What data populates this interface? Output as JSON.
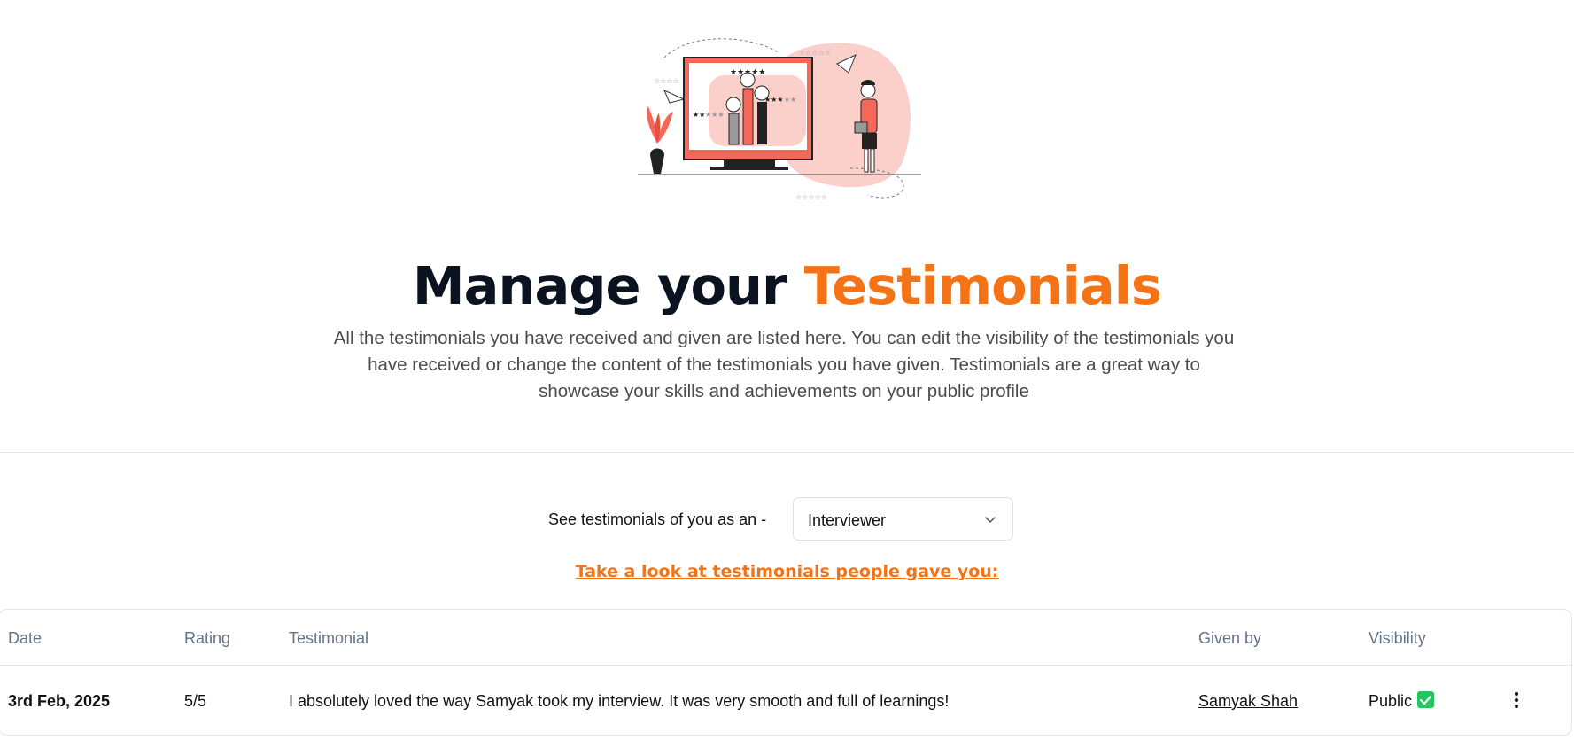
{
  "hero": {
    "illustration": "testimonials-rating-illustration",
    "title_main": "Manage your ",
    "title_accent": "Testimonials",
    "subtitle": "All the testimonials you have received and given are listed here. You can edit the visibility of the testimonials you have received or change the content of the testimonials you have given. Testimonials are a great way to showcase your skills and achievements on your public profile"
  },
  "filter": {
    "label": "See testimonials of you as an -",
    "selected": "Interviewer"
  },
  "section_link": "Take a look at testimonials people gave you:",
  "table": {
    "headers": {
      "date": "Date",
      "rating": "Rating",
      "testimonial": "Testimonial",
      "given_by": "Given by",
      "visibility": "Visibility"
    },
    "rows": [
      {
        "date": "3rd Feb, 2025",
        "rating": "5/5",
        "testimonial": "I absolutely loved the way Samyak took my interview. It was very smooth and full of learnings!",
        "given_by": "Samyak Shah",
        "visibility": "Public",
        "visibility_checked": true
      }
    ]
  },
  "colors": {
    "accent": "#f47316",
    "title": "#0b1220",
    "muted_header": "#647387",
    "check": "#22c55e",
    "illustration_coral": "#f4685a",
    "illustration_blush": "#fbcfca"
  }
}
